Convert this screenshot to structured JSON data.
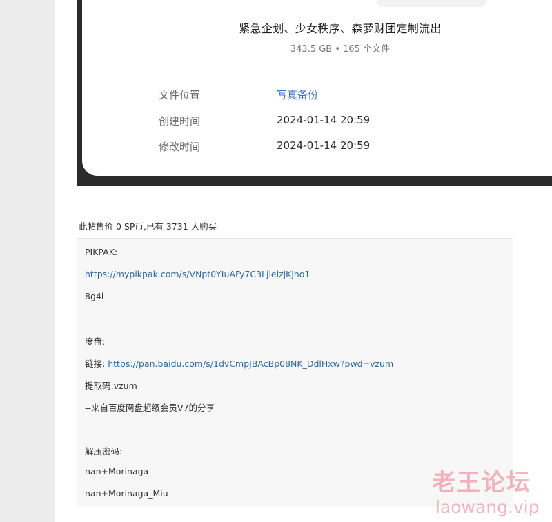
{
  "file_card": {
    "folder_name": "紧急企划、少女秩序、森萝财团定制流出",
    "folder_meta": "343.5 GB • 165 个文件",
    "rows": [
      {
        "label": "文件位置",
        "value": "写真备份"
      },
      {
        "label": "创建时间",
        "value": "2024-01-14 20:59"
      },
      {
        "label": "修改时间",
        "value": "2024-01-14 20:59"
      }
    ]
  },
  "sale_info": "此帖售价 0 SP币,已有 3731 人购买",
  "content": {
    "pikpak_label": "PIKPAK:",
    "pikpak_url": "https://mypikpak.com/s/VNpt0YIuAFy7C3LjlelzjKjho1",
    "pikpak_code": "8g4i",
    "baidu_label": "度盘:",
    "baidu_link_prefix": "链接:",
    "baidu_url": "https://pan.baidu.com/s/1dvCmpJBAcBp08NK_DdlHxw?pwd=vzum",
    "baidu_code": "提取码:vzum",
    "baidu_share": "--来自百度网盘超级会员V7的分享",
    "unzip_label": "解压密码:",
    "password_1": "nan+Morinaga",
    "password_2": "nan+Morinaga_Miu"
  },
  "watermark": {
    "cn": "老王论坛",
    "en": "laowang.vip"
  }
}
